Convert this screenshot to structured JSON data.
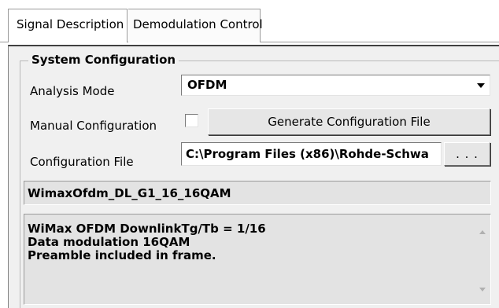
{
  "tabs": [
    {
      "label": "Signal Description"
    },
    {
      "label": "Demodulation Control"
    }
  ],
  "group": {
    "title": "System Configuration"
  },
  "analysis_mode": {
    "label": "Analysis Mode",
    "value": "OFDM"
  },
  "manual_configuration": {
    "label": "Manual Configuration",
    "checked": false,
    "button_label": "Generate Configuration File"
  },
  "configuration_file": {
    "label": "Configuration File",
    "value": "C:\\Program Files (x86)\\Rohde-Schwa",
    "browse_label": ". . ."
  },
  "selected_config_name": "WimaxOfdm_DL_G1_16_16QAM",
  "description": {
    "lines": [
      "WiMax OFDM DownlinkTg/Tb = 1/16",
      "Data modulation 16QAM",
      "Preamble included in frame."
    ]
  }
}
